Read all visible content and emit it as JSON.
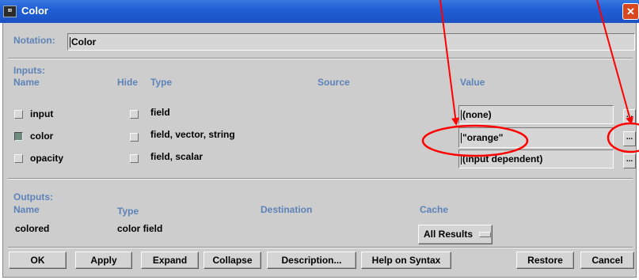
{
  "window": {
    "title": "Color",
    "close_glyph": "✕",
    "icon": "app-icon",
    "icon_glyph": "⌧"
  },
  "notation": {
    "label": "Notation:",
    "value": "Color"
  },
  "inputs": {
    "section_label": "Inputs:",
    "headers": {
      "name": "Name",
      "hide": "Hide",
      "type": "Type",
      "source": "Source",
      "value": "Value"
    },
    "rows": [
      {
        "name": "input",
        "checked": false,
        "hide": false,
        "type": "field",
        "value": "(none)",
        "ellipsis": "..."
      },
      {
        "name": "color",
        "checked": true,
        "hide": false,
        "type": "field, vector, string",
        "value": "\"orange\"",
        "ellipsis": "..."
      },
      {
        "name": "opacity",
        "checked": false,
        "hide": false,
        "type": "field, scalar",
        "value": "(input dependent)",
        "ellipsis": "..."
      }
    ]
  },
  "outputs": {
    "section_label": "Outputs:",
    "headers": {
      "name": "Name",
      "type": "Type",
      "destination": "Destination",
      "cache": "Cache"
    },
    "rows": [
      {
        "name": "colored",
        "type": "color field",
        "cache": "All Results"
      }
    ]
  },
  "buttons": {
    "ok": "OK",
    "apply": "Apply",
    "expand": "Expand",
    "collapse": "Collapse",
    "description": "Description...",
    "help": "Help on Syntax",
    "restore": "Restore",
    "cancel": "Cancel"
  },
  "annotation": {
    "color": "#ff0000"
  }
}
